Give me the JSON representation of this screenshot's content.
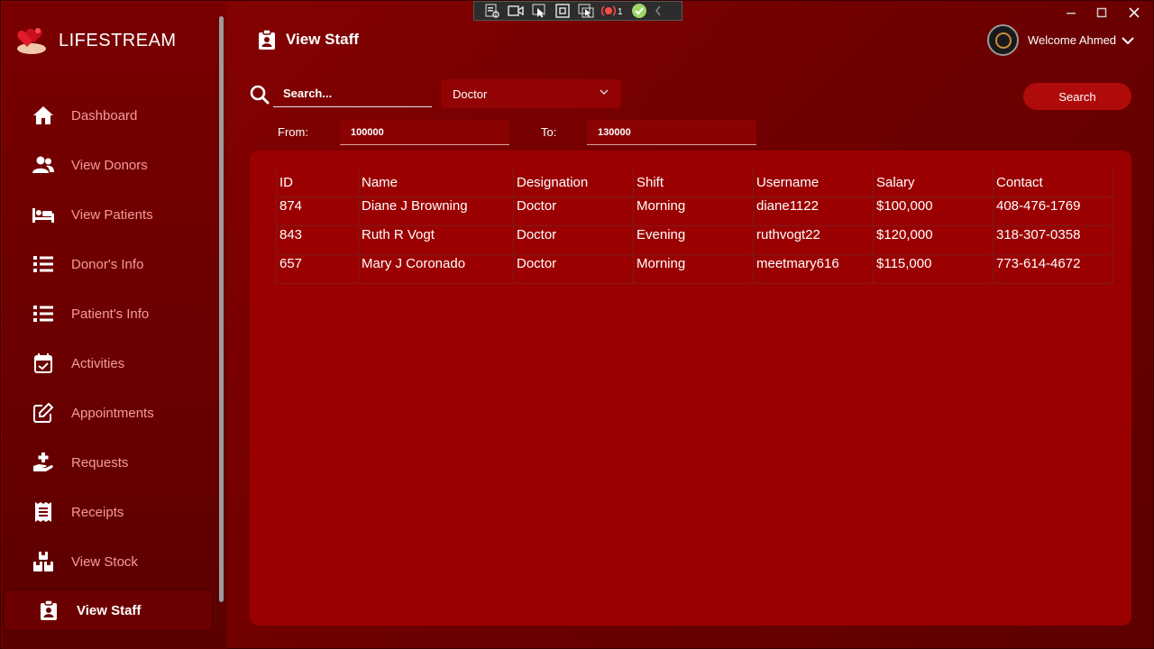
{
  "app": {
    "name": "LIFESTREAM"
  },
  "sidebar": {
    "items": [
      {
        "label": "Dashboard",
        "icon": "home-icon"
      },
      {
        "label": "View Donors",
        "icon": "users-icon"
      },
      {
        "label": "View Patients",
        "icon": "bed-icon"
      },
      {
        "label": "Donor's Info",
        "icon": "list-icon"
      },
      {
        "label": "Patient's Info",
        "icon": "list-icon"
      },
      {
        "label": "Activities",
        "icon": "calendar-check-icon"
      },
      {
        "label": "Appointments",
        "icon": "edit-icon"
      },
      {
        "label": "Requests",
        "icon": "hand-medical-icon"
      },
      {
        "label": "Receipts",
        "icon": "receipt-icon"
      },
      {
        "label": "View Stock",
        "icon": "boxes-icon"
      },
      {
        "label": "View Staff",
        "icon": "clipboard-user-icon",
        "active": true
      }
    ]
  },
  "header": {
    "title": "View Staff",
    "welcome": "Welcome Ahmed"
  },
  "toolbar_strip": {
    "badge_count": "1"
  },
  "filters": {
    "search_placeholder": "Search...",
    "designation_selected": "Doctor",
    "search_button": "Search",
    "from_label": "From:",
    "from_value": "100000",
    "to_label": "To:",
    "to_value": "130000"
  },
  "table": {
    "columns": [
      "ID",
      "Name",
      "Designation",
      "Shift",
      "Username",
      "Salary",
      "Contact"
    ],
    "rows": [
      [
        "874",
        "Diane J Browning",
        "Doctor",
        "Morning",
        "diane1122",
        "$100,000",
        "408-476-1769"
      ],
      [
        "843",
        "Ruth R Vogt",
        "Doctor",
        "Evening",
        "ruthvogt22",
        "$120,000",
        "318-307-0358"
      ],
      [
        "657",
        "Mary J Coronado",
        "Doctor",
        "Morning",
        "meetmary616",
        "$115,000",
        "773-614-4672"
      ]
    ]
  },
  "colors": {
    "sidebar_text": "#f49b9b",
    "panel_bg": "#9b0000",
    "button_bg": "#b00b0b"
  }
}
